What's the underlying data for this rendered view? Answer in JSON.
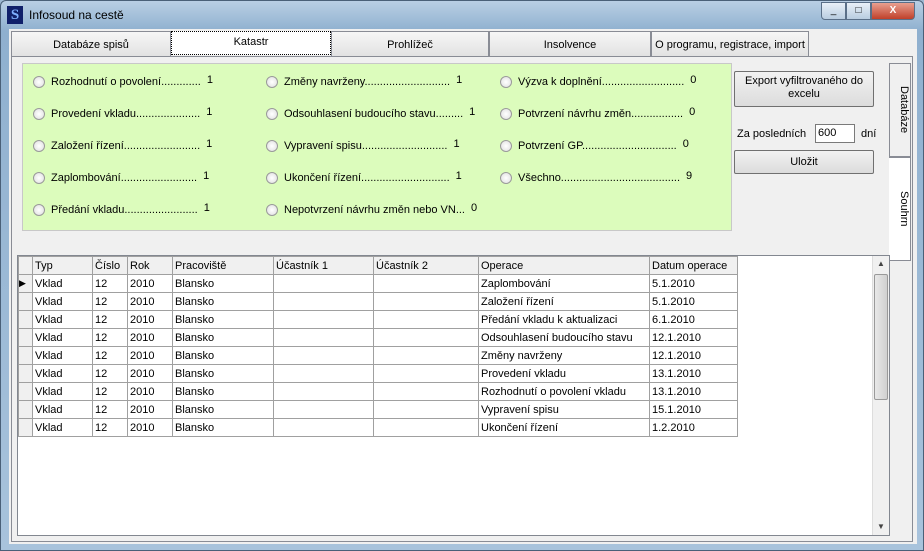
{
  "window": {
    "title": "Infosoud na cestě",
    "logo": "S"
  },
  "tabs": [
    "Databáze spisů",
    "Katastr",
    "Prohlížeč",
    "Insolvence",
    "O programu, registrace, import"
  ],
  "filters": [
    {
      "label": "Rozhodnutí o povolení.............",
      "count": "1"
    },
    {
      "label": "Provedení vkladu.....................",
      "count": "1"
    },
    {
      "label": "Založení řízení.........................",
      "count": "1"
    },
    {
      "label": "Zaplombování.........................",
      "count": "1"
    },
    {
      "label": "Předání vkladu........................",
      "count": "1"
    },
    {
      "label": "Změny navrženy............................",
      "count": "1"
    },
    {
      "label": "Odsouhlasení budoucího stavu.........",
      "count": "1"
    },
    {
      "label": "Vypravení spisu............................",
      "count": "1"
    },
    {
      "label": "Ukončení řízení.............................",
      "count": "1"
    },
    {
      "label": "Nepotvrzení návrhu změn nebo VN...",
      "count": "0"
    },
    {
      "label": "Výzva k doplnění...........................",
      "count": "0"
    },
    {
      "label": "Potvrzení návrhu změn.................",
      "count": "0"
    },
    {
      "label": "Potvrzení GP...............................",
      "count": "0"
    },
    {
      "label": "Všechno.......................................",
      "count": "9"
    }
  ],
  "export_button": "Export vyfiltrovaného do excelu",
  "days": {
    "prefix": "Za posledních",
    "value": "600",
    "suffix": "dní"
  },
  "save_button": "Uložit",
  "side_tabs": [
    "Databáze",
    "Souhrn"
  ],
  "table": {
    "columns": [
      "Typ",
      "Číslo",
      "Rok",
      "Pracoviště",
      "Účastník 1",
      "Účastník 2",
      "Operace",
      "Datum operace"
    ],
    "rows": [
      [
        "Vklad",
        "12",
        "2010",
        "Blansko",
        "",
        "",
        "Zaplombování",
        "5.1.2010"
      ],
      [
        "Vklad",
        "12",
        "2010",
        "Blansko",
        "",
        "",
        "Založení řízení",
        "5.1.2010"
      ],
      [
        "Vklad",
        "12",
        "2010",
        "Blansko",
        "",
        "",
        "Předání vkladu k aktualizaci",
        "6.1.2010"
      ],
      [
        "Vklad",
        "12",
        "2010",
        "Blansko",
        "",
        "",
        "Odsouhlasení budoucího stavu",
        "12.1.2010"
      ],
      [
        "Vklad",
        "12",
        "2010",
        "Blansko",
        "",
        "",
        "Změny navrženy",
        "12.1.2010"
      ],
      [
        "Vklad",
        "12",
        "2010",
        "Blansko",
        "",
        "",
        "Provedení vkladu",
        "13.1.2010"
      ],
      [
        "Vklad",
        "12",
        "2010",
        "Blansko",
        "",
        "",
        "Rozhodnutí o povolení vkladu",
        "13.1.2010"
      ],
      [
        "Vklad",
        "12",
        "2010",
        "Blansko",
        "",
        "",
        "Vypravení spisu",
        "15.1.2010"
      ],
      [
        "Vklad",
        "12",
        "2010",
        "Blansko",
        "",
        "",
        "Ukončení řízení",
        "1.2.2010"
      ]
    ]
  }
}
